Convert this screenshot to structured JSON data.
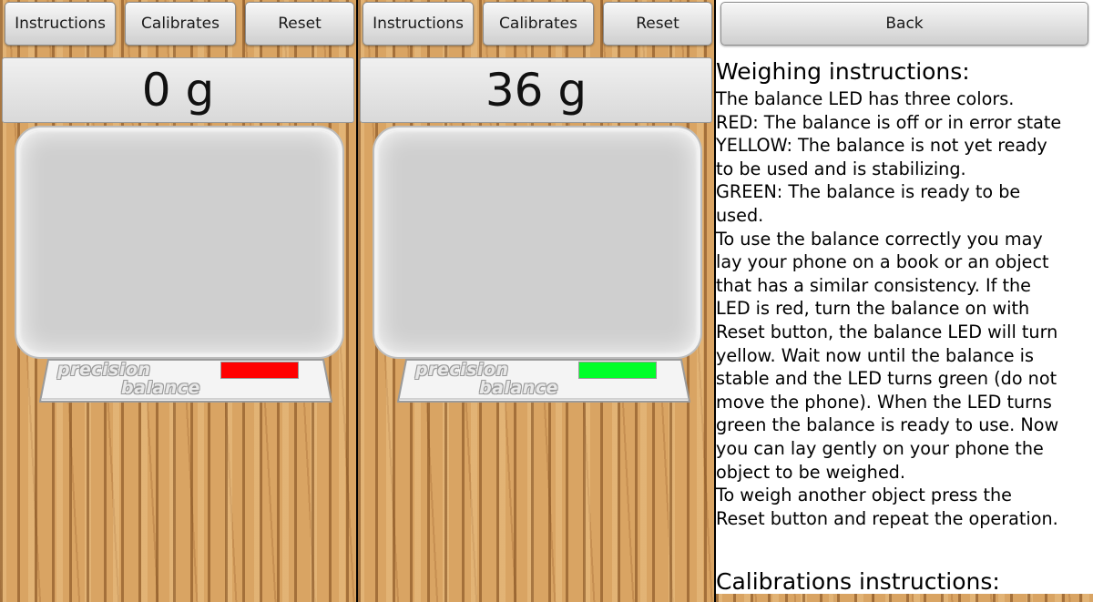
{
  "panels": [
    {
      "buttons": {
        "instructions": "Instructions",
        "calibrates": "Calibrates",
        "reset": "Reset"
      },
      "weight": "0 g",
      "brand": {
        "line1": "precision",
        "line2": "balance"
      },
      "led_color": "#ff0000"
    },
    {
      "buttons": {
        "instructions": "Instructions",
        "calibrates": "Calibrates",
        "reset": "Reset"
      },
      "weight": "36 g",
      "brand": {
        "line1": "precision",
        "line2": "balance"
      },
      "led_color": "#00ff2a"
    }
  ],
  "instructions_screen": {
    "back_label": "Back",
    "heading": "Weighing instructions:",
    "lines": [
      "The balance LED has three colors.",
      "RED: The balance is off or in error state",
      "YELLOW: The balance is not yet ready",
      "to be used and is stabilizing.",
      "GREEN: The balance is ready to be",
      "used.",
      "To use the balance correctly you may",
      "lay your phone on a book or an object",
      "that has a similar consistency. If the",
      "LED is red, turn the balance on with",
      "Reset button, the balance LED will turn",
      "yellow. Wait now until the balance is",
      "stable and the LED turns green (do not",
      "move the phone). When the LED turns",
      "green the balance is ready to use. Now",
      "you can lay gently on your phone the",
      "object to be weighed.",
      "To weigh another object press the",
      "Reset button and repeat the operation."
    ],
    "calibration_heading": "Calibrations instructions:"
  },
  "colors": {
    "wood": "#d9a463",
    "led_red": "#ff0000",
    "led_green": "#00ff2a"
  }
}
